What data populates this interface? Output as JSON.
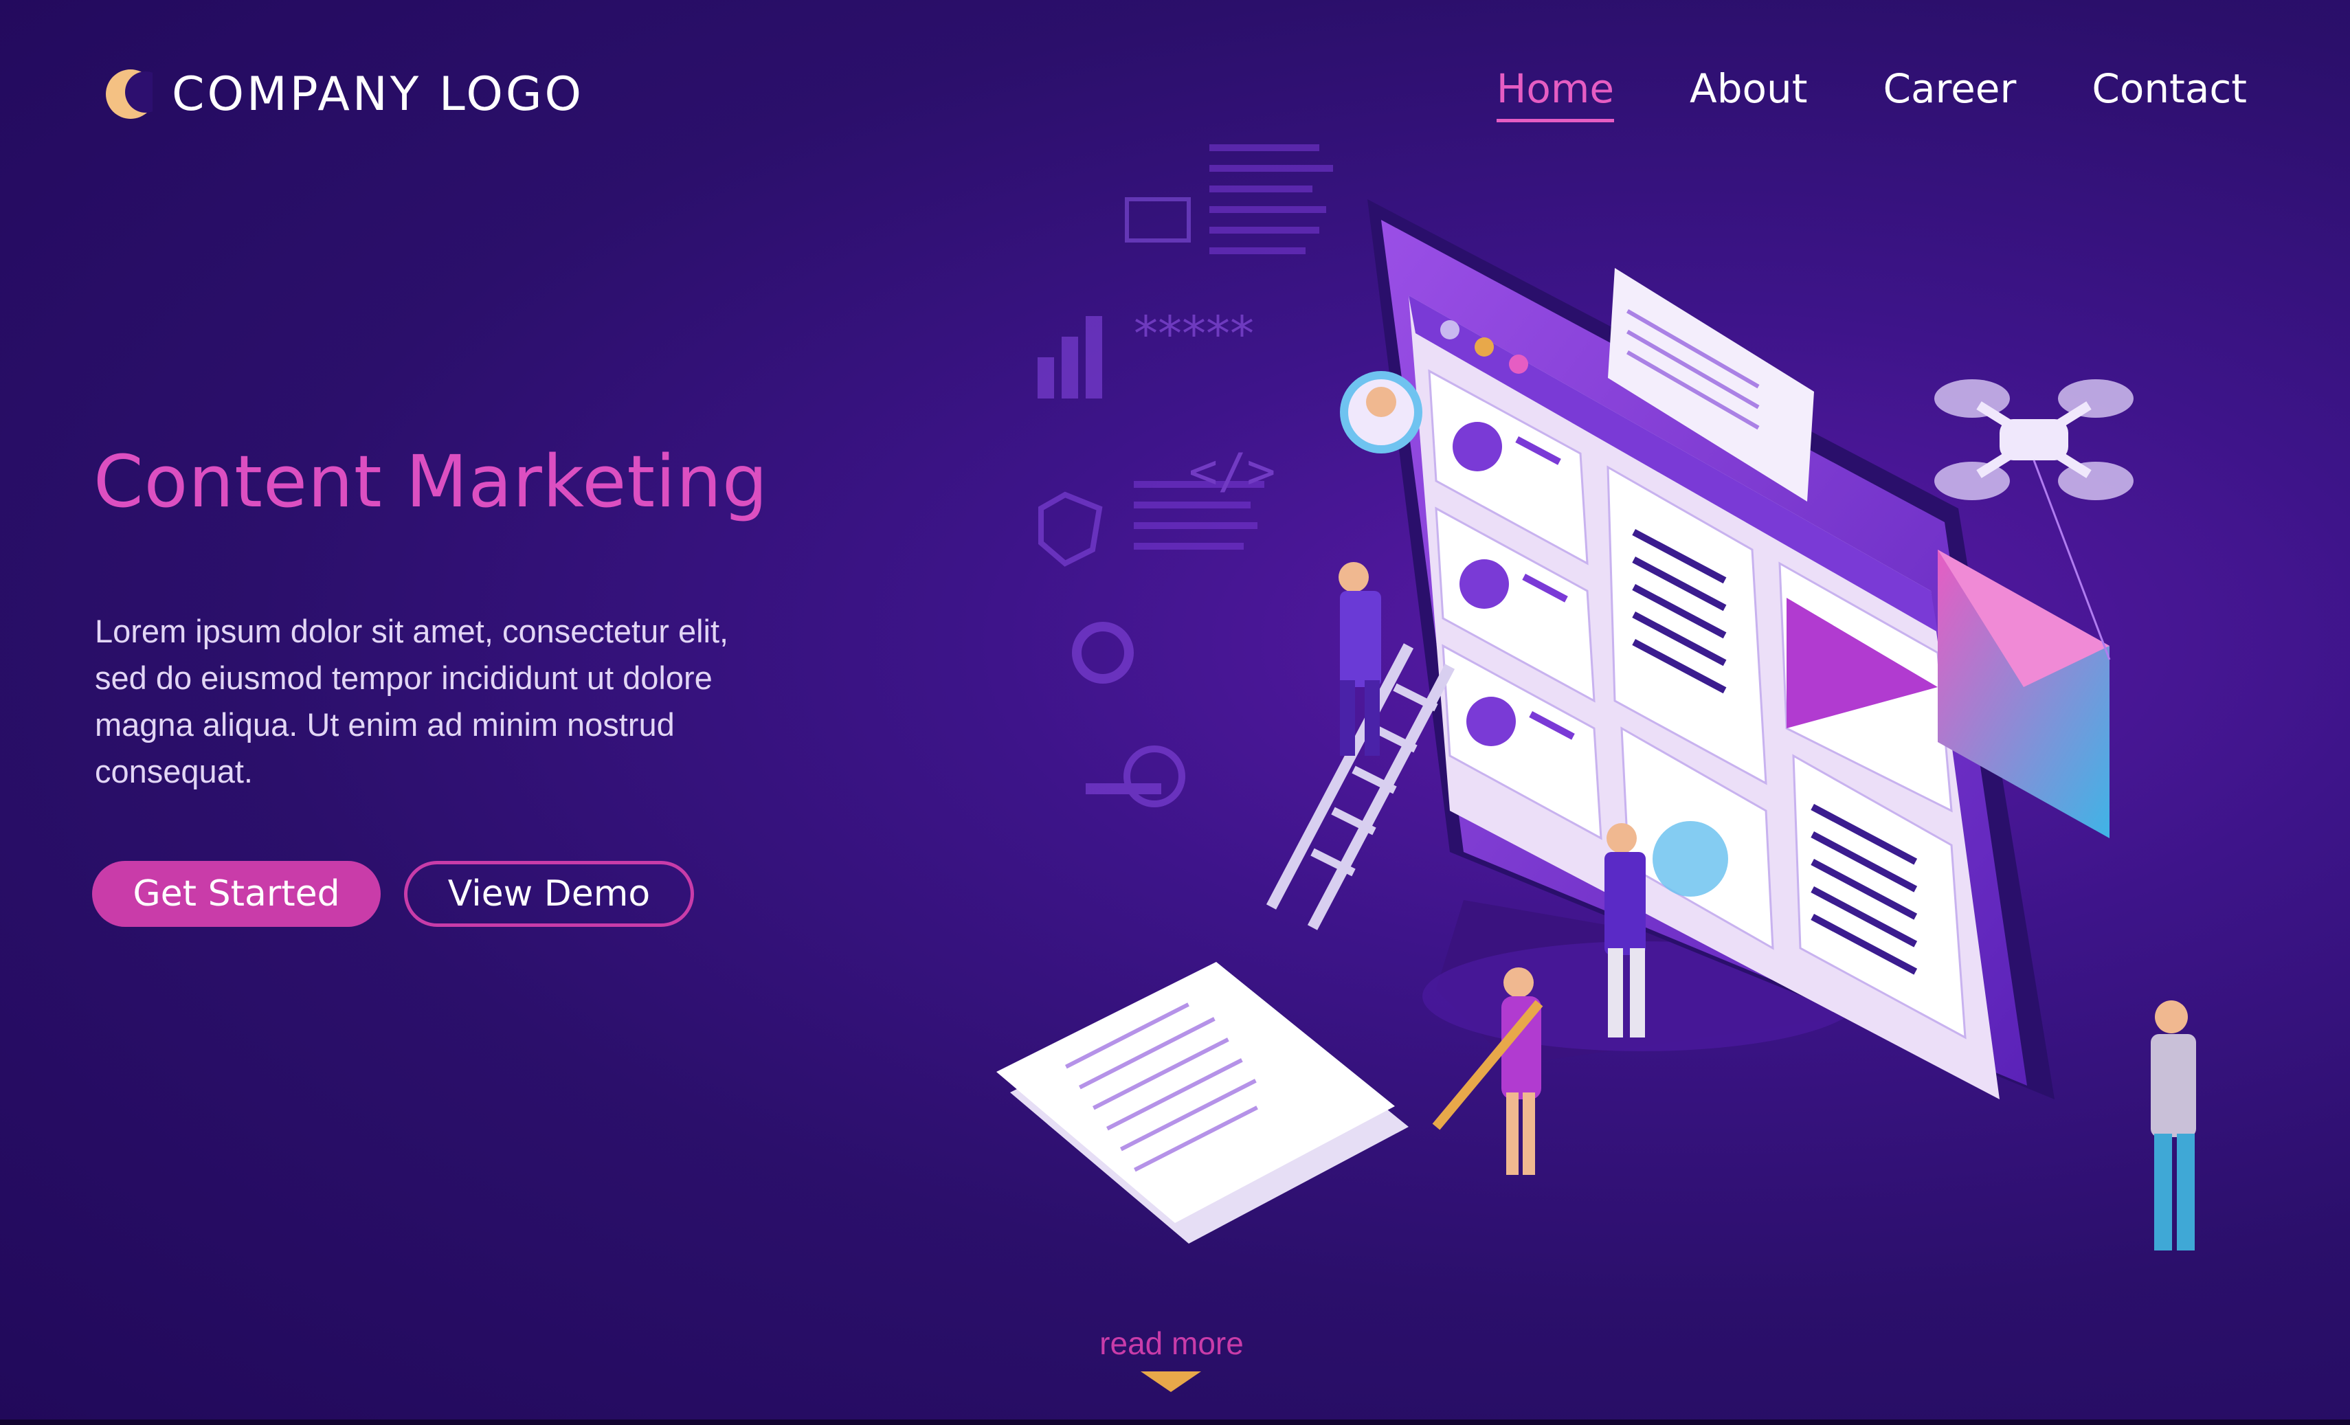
{
  "header": {
    "logo_text": "COMPANY LOGO",
    "logo_icon": "crescent-moon-icon",
    "nav": [
      {
        "label": "Home",
        "active": true
      },
      {
        "label": "About",
        "active": false
      },
      {
        "label": "Career",
        "active": false
      },
      {
        "label": "Contact",
        "active": false
      }
    ]
  },
  "hero": {
    "title": "Content Marketing",
    "description": "Lorem ipsum dolor sit amet, consectetur elit, sed do eiusmod tempor incididunt ut dolore magna aliqua. Ut enim ad minim nostrud consequat.",
    "primary_button": "Get Started",
    "secondary_button": "View Demo"
  },
  "footer": {
    "read_more": "read more"
  },
  "illustration": {
    "floating_stars": "*****",
    "code_glyph": "</>"
  },
  "colors": {
    "background": "#2b0f6b",
    "accent": "#dc4fc1",
    "button": "#c93ca9",
    "logo": "#f4c183",
    "arrow": "#e8a84a"
  }
}
